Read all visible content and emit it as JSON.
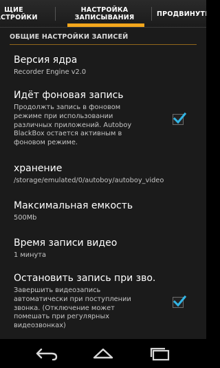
{
  "tabs": [
    {
      "label": "ЩИЕ\nНАСТРОЙКИ"
    },
    {
      "label": "НАСТРОЙКА\nЗАПИСЫВАНИЯ"
    },
    {
      "label": "ПРОДВИНУТЫ"
    }
  ],
  "section": {
    "title": "ОБЩИЕ НАСТРОЙКИ ЗАПИСЕЙ"
  },
  "prefs": [
    {
      "title": "Версия ядра",
      "summary": "Recorder Engine v2.0"
    },
    {
      "title": "Идёт фоновая запись",
      "summary": "Продолжть запись в фоновом режиме при использовании различных приложений. Autoboy BlackBox остается активным в фоновом режиме.",
      "checked": true
    },
    {
      "title": "хранение",
      "summary": "/storage/emulated/0/autoboy/autoboy_video"
    },
    {
      "title": "Максимальная емкость",
      "summary": "500Mb"
    },
    {
      "title": "Время записи видео",
      "summary": "1 минута"
    },
    {
      "title": "Остановить запись при зво.",
      "summary": "Завершить видеозапись автоматически при поступлении звонка. (Отключение может помешать при регулярных видеозвонках)",
      "checked": true
    }
  ],
  "colors": {
    "accent": "#f3a61c",
    "check": "#33b5e5",
    "background": "#1b1b1b"
  },
  "navbar": {
    "icons": [
      "back-icon",
      "home-icon",
      "recents-icon"
    ]
  }
}
